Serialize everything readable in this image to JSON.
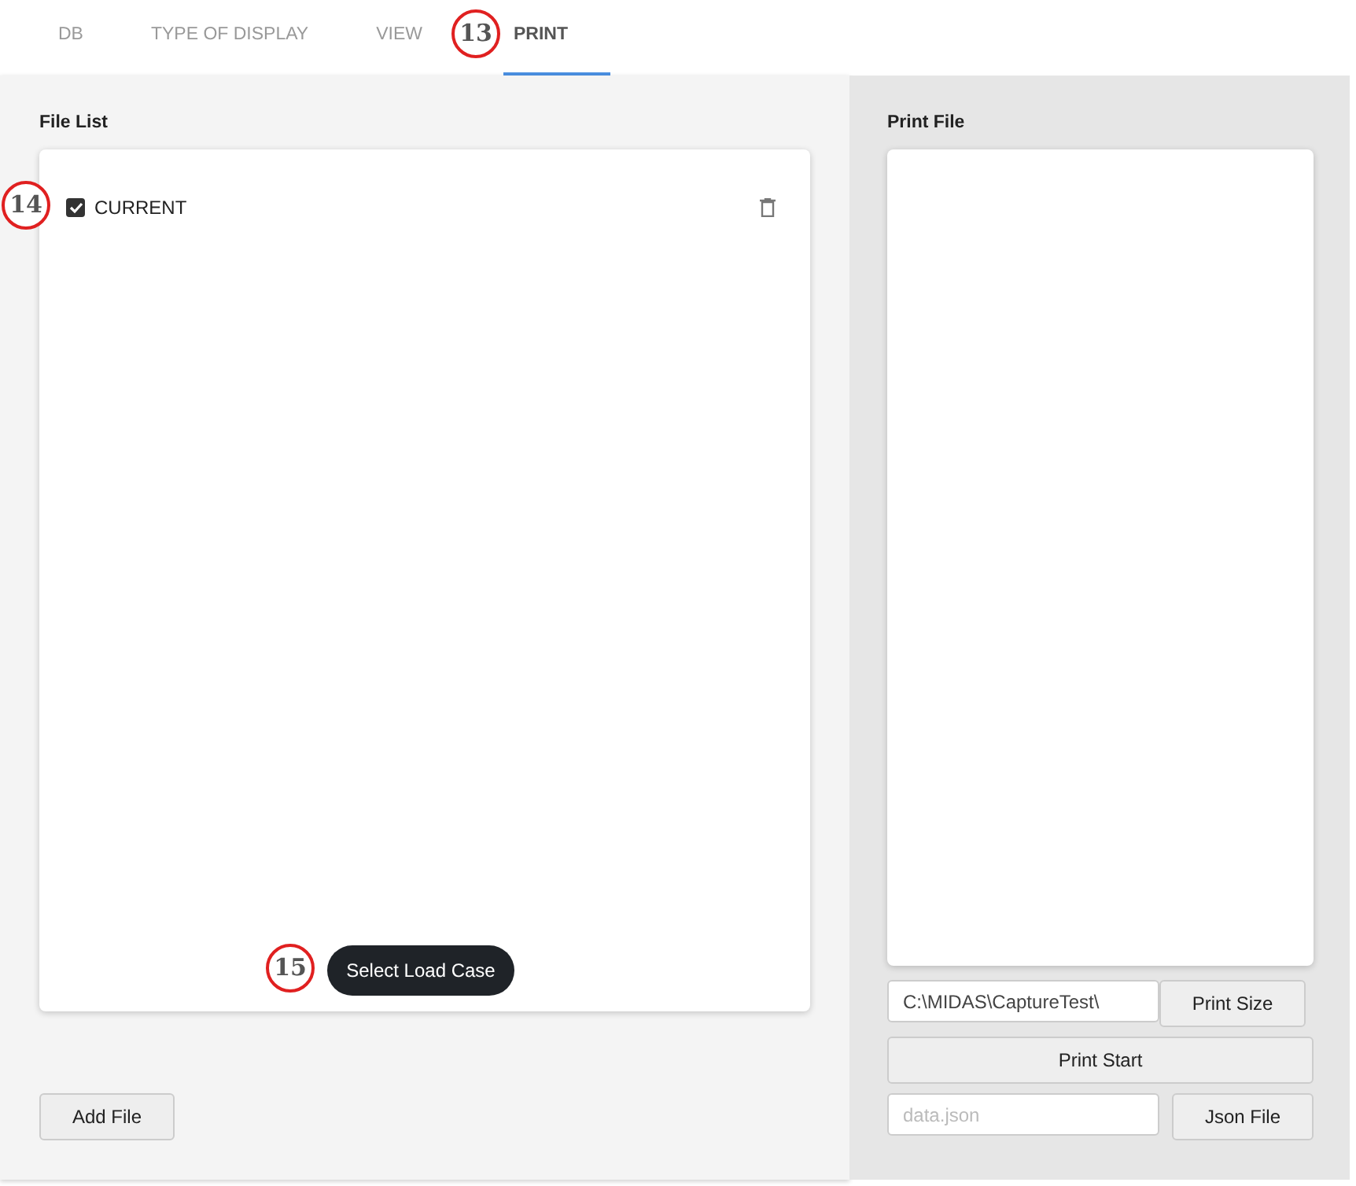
{
  "tabs": [
    {
      "label": "DB",
      "selected": false
    },
    {
      "label": "TYPE OF DISPLAY",
      "selected": false
    },
    {
      "label": "VIEW",
      "selected": false
    },
    {
      "label": "PRINT",
      "selected": true
    }
  ],
  "file_list": {
    "title": "File List",
    "items": [
      {
        "label": "CURRENT",
        "checked": true
      }
    ],
    "select_button": "Select Load Case",
    "add_button": "Add File"
  },
  "print_file": {
    "title": "Print File",
    "path_field": {
      "value": "C:\\MIDAS\\CaptureTest\\"
    },
    "print_size_button": "Print Size",
    "print_start_button": "Print Start",
    "json_field": {
      "placeholder": "data.json"
    },
    "json_button": "Json File"
  },
  "callouts": [
    {
      "label": "13"
    },
    {
      "label": "14"
    },
    {
      "label": "15"
    }
  ]
}
